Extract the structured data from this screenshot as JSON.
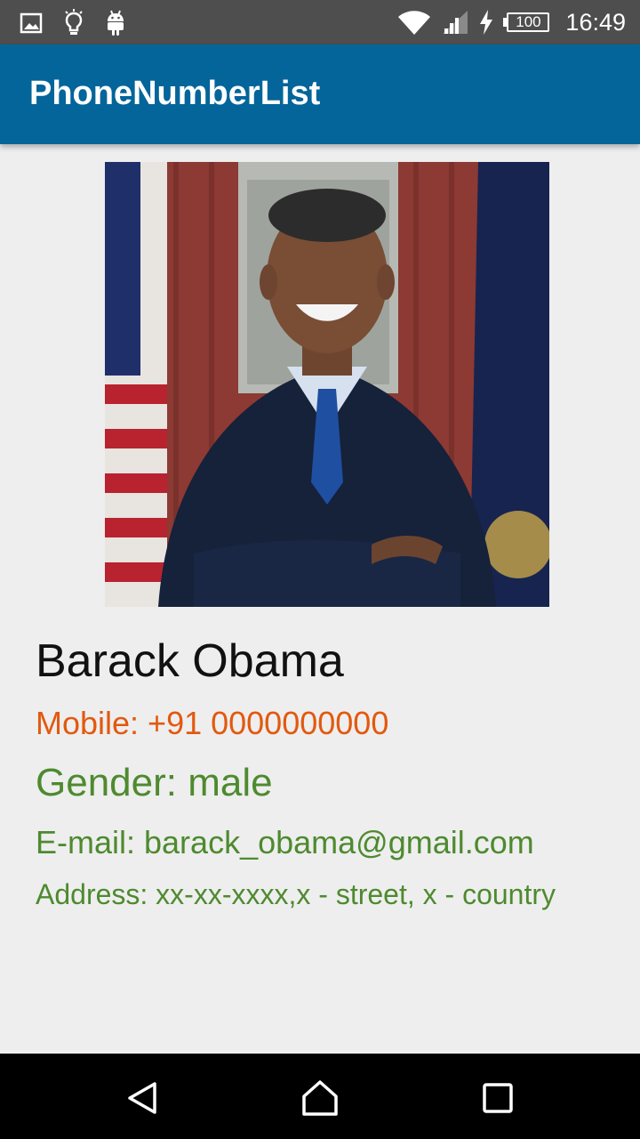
{
  "status_bar": {
    "icons_left": [
      "image-icon",
      "lightbulb-icon",
      "android-icon"
    ],
    "icons_right": [
      "wifi-icon",
      "signal-icon",
      "charging-icon"
    ],
    "battery_level": "100",
    "time": "16:49"
  },
  "app_bar": {
    "title": "PhoneNumberList",
    "color": "#03659a"
  },
  "contact": {
    "photo": "person-in-dark-suit-with-flags-photo",
    "name": "Barack Obama",
    "mobile": "Mobile: +91 0000000000",
    "gender": "Gender: male",
    "email": "E-mail: barack_obama@gmail.com",
    "address": "Address: xx-xx-xxxx,x - street, x - country"
  },
  "colors": {
    "mobile": "#e2590f",
    "details": "#4e8a2f",
    "name": "#111111"
  },
  "nav_bar": {
    "buttons": [
      "back-icon",
      "home-icon",
      "recent-apps-icon"
    ]
  }
}
